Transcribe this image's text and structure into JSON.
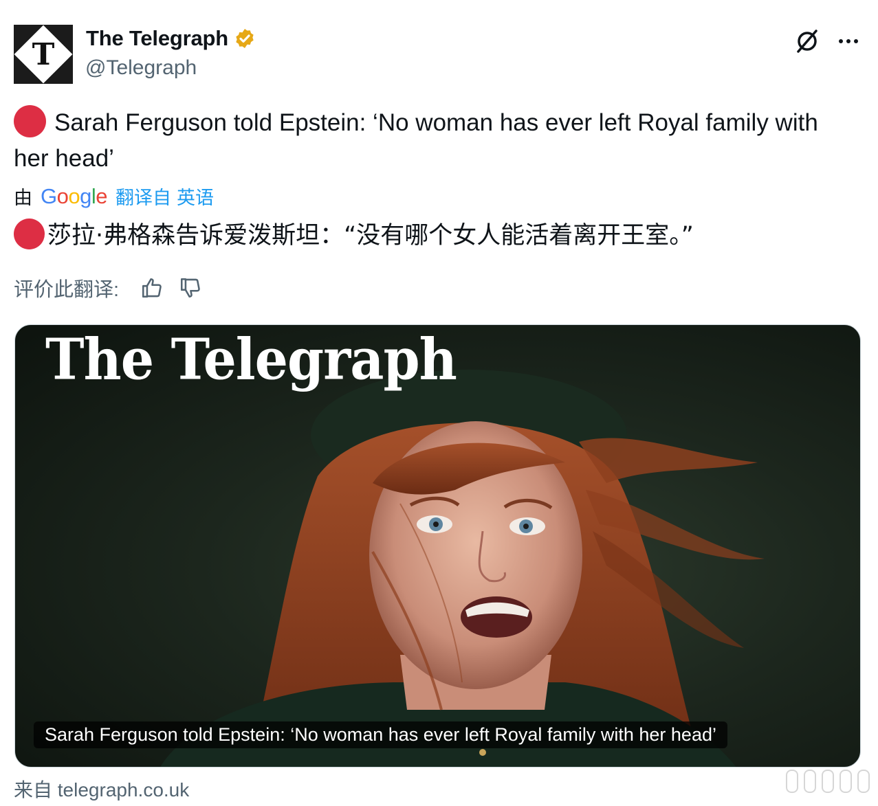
{
  "header": {
    "display_name": "The Telegraph",
    "handle": "@Telegraph",
    "avatar_glyph": "T",
    "icons": {
      "verified": "verified-badge-icon",
      "grok": "grok-icon",
      "more": "more-icon"
    },
    "verified_color": "#e6a817"
  },
  "post": {
    "text": "Sarah Ferguson told Epstein: ‘No woman has ever left Royal family with her head’",
    "emoji": "red-circle"
  },
  "translation": {
    "prefix": "由",
    "provider": "Google",
    "action": "翻译自",
    "language": "英语",
    "text": "莎拉·弗格森告诉爱泼斯坦：“没有哪个女人能活着离开王室。”"
  },
  "rate": {
    "label": "评价此翻译:",
    "icons": {
      "up": "thumbs-up-icon",
      "down": "thumbs-down-icon"
    }
  },
  "card": {
    "masthead": "The Telegraph",
    "caption": "Sarah Ferguson told Epstein: ‘No woman has ever left Royal family with her head’"
  },
  "source": {
    "label": "来自 telegraph.co.uk"
  },
  "colors": {
    "accent": "#1d9bf0",
    "secondary_text": "#536471",
    "red_dot": "#dd2e44"
  }
}
